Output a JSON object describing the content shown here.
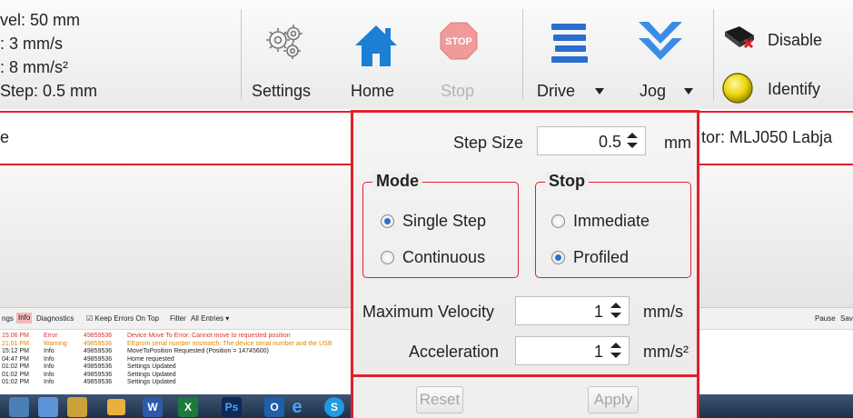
{
  "toolbar": {
    "status_lines": [
      "vel: 50 mm",
      ": 3 mm/s",
      ": 8 mm/s²",
      "Step: 0.5 mm"
    ],
    "settings_label": "Settings",
    "home_label": "Home",
    "stop_label": "Stop",
    "stop_sign_text": "STOP",
    "drive_label": "Drive",
    "jog_label": "Jog",
    "disable_label": "Disable",
    "identify_label": "Identify",
    "icons": {
      "settings": "gears-icon",
      "home": "house-icon",
      "stop": "stop-sign-icon",
      "drive": "drive-stack-icon",
      "jog": "double-chevron-down-icon",
      "disable": "disable-device-icon",
      "identify": "identify-led-icon"
    }
  },
  "statusbar": {
    "left_text": "e",
    "controller_text": "tor:  MLJ050 Labja"
  },
  "popup": {
    "step_size_label": "Step Size",
    "step_size_value": "0.5",
    "step_size_unit": "mm",
    "mode_title": "Mode",
    "mode_options": [
      "Single Step",
      "Continuous"
    ],
    "mode_selected": "Single Step",
    "stop_title": "Stop",
    "stop_options": [
      "Immediate",
      "Profiled"
    ],
    "stop_selected": "Profiled",
    "max_velocity_label": "Maximum Velocity",
    "max_velocity_value": "1",
    "max_velocity_unit": "mm/s",
    "acceleration_label": "Acceleration",
    "acceleration_value": "1",
    "acceleration_unit": "mm/s²",
    "reset_label": "Reset",
    "apply_label": "Apply"
  },
  "log": {
    "tabs": [
      "ngs",
      "Info",
      "Diagnostics",
      "Keep Errors On Top",
      "Filter",
      "All Entries ▾"
    ],
    "right_tabs": [
      "Pause",
      "Sav"
    ],
    "rows": [
      {
        "time": "15:06 PM",
        "type": "Error",
        "id": "49859536",
        "message": "Device Move To Error: Cannot move to requested position",
        "level": "err"
      },
      {
        "time": "21:01 PM",
        "type": "Warning",
        "id": "49859536",
        "message": "EEprom serial number mismatch: The device serial number and the USB",
        "level": "warn"
      },
      {
        "time": "15:12 PM",
        "type": "Info",
        "id": "49859536",
        "message": "MoveToPosition Requested (Position = 14745600)",
        "level": "info"
      },
      {
        "time": "04:47 PM",
        "type": "Info",
        "id": "49859536",
        "message": "Home requested",
        "level": "info"
      },
      {
        "time": "01:02 PM",
        "type": "Info",
        "id": "49859536",
        "message": "Settings Updated",
        "level": "info"
      },
      {
        "time": "01:02 PM",
        "type": "Info",
        "id": "49859536",
        "message": "Settings Updated",
        "level": "info"
      },
      {
        "time": "01:02 PM",
        "type": "Info",
        "id": "49859536",
        "message": "Settings Updated",
        "level": "info"
      }
    ]
  },
  "taskbar": {
    "icons": [
      "explorer-icon",
      "media-icon",
      "folder-icon",
      "word-icon",
      "excel-icon",
      "photoshop-icon",
      "outlook-icon",
      "ie-icon",
      "skype-icon"
    ]
  }
}
